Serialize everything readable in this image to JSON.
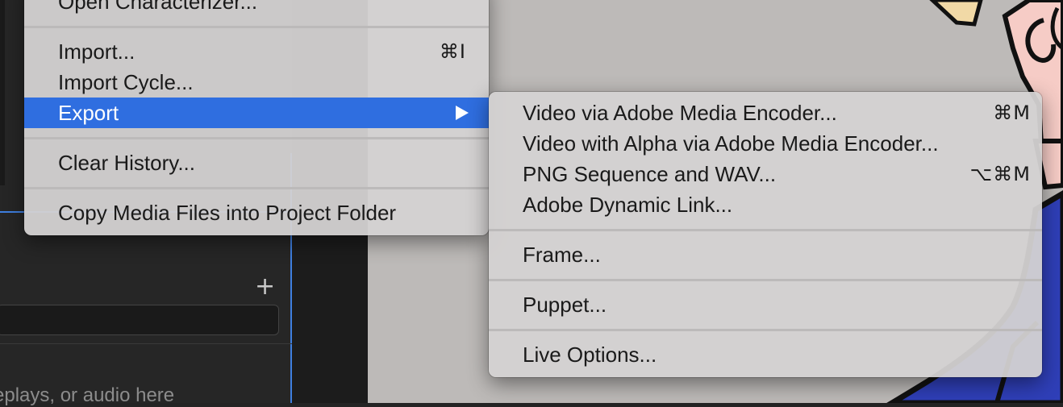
{
  "background": {
    "add_button": "+",
    "drop_hint": "eplays, or audio here"
  },
  "main_menu": {
    "items": [
      {
        "label": "Open Characterizer..."
      },
      {
        "label": "Import...",
        "shortcut": "⌘I"
      },
      {
        "label": "Import Cycle..."
      },
      {
        "label": "Export",
        "submenu": true,
        "highlighted": true
      },
      {
        "label": "Clear History..."
      },
      {
        "label": "Copy Media Files into Project Folder"
      }
    ]
  },
  "export_submenu": {
    "items": [
      {
        "label": "Video via Adobe Media Encoder...",
        "shortcut": "⌘M"
      },
      {
        "label": "Video with Alpha via Adobe Media Encoder..."
      },
      {
        "label": "PNG Sequence and WAV...",
        "shortcut": "⌥⌘M"
      },
      {
        "label": "Adobe Dynamic Link..."
      },
      {
        "label": "Frame..."
      },
      {
        "label": "Puppet..."
      },
      {
        "label": "Live Options..."
      }
    ]
  },
  "colors": {
    "highlight": "#2f6ee0",
    "menu_bg": "#d4d2d2",
    "panel_bg": "#262626",
    "panel_accent": "#3f7fe0",
    "stage_bg": "#bdbab8"
  }
}
